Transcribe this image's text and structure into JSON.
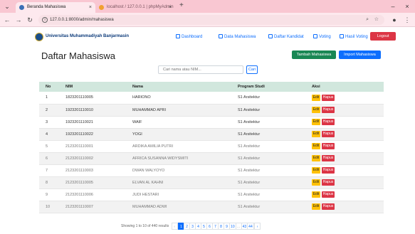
{
  "browser": {
    "tabs": [
      {
        "title": "Beranda Mahasiswa",
        "favicon_color": "#3b6fb6"
      },
      {
        "title": "localhost / 127.0.0.1 | phpMyAdmin",
        "favicon_color": "#f0a030"
      }
    ],
    "url": "127.0.0.1:8000/admin/mahasiswa",
    "new_tab": "+",
    "tab_close": "×",
    "win_controls": {
      "minimize": "–",
      "close": "×",
      "menu": "⌄"
    },
    "nav": {
      "back": "←",
      "forward": "→",
      "reload": "↻"
    },
    "omni_icons": {
      "info": "i",
      "zoom": "⌕",
      "star": "☆",
      "profile": "●",
      "kebab": "⋮"
    }
  },
  "navbar": {
    "brand": "Universitas Muhammadiyah Banjarmasin",
    "links": [
      {
        "label": "Dashboard",
        "icon": "dashboard-icon"
      },
      {
        "label": "Data Mahasiswa",
        "icon": "users-icon"
      },
      {
        "label": "Daftar Kandidat",
        "icon": "list-icon"
      },
      {
        "label": "Voting",
        "icon": "vote-icon"
      },
      {
        "label": "Hasil Voting",
        "icon": "chart-icon"
      }
    ],
    "logout": "Logout"
  },
  "page": {
    "title": "Daftar Mahasiswa",
    "add_button": "Tambah Mahasiswa",
    "import_button": "Import Mahasiswa",
    "search_placeholder": "Cari nama atau NIM...",
    "search_button": "Cari"
  },
  "table": {
    "columns": [
      "No",
      "NIM",
      "Nama",
      "Program Studi",
      "Aksi"
    ],
    "rows": [
      {
        "no": "1",
        "nim": "1823201110005",
        "nama": "HARIONO",
        "prodi": "S1 Arsitektur"
      },
      {
        "no": "2",
        "nim": "1923201110010",
        "nama": "MUHAMMAD APRI",
        "prodi": "S1 Arsitektur"
      },
      {
        "no": "3",
        "nim": "1923201110021",
        "nama": "WAIF",
        "prodi": "S1 Arsitektur"
      },
      {
        "no": "4",
        "nim": "1923201110022",
        "nama": "YOGI",
        "prodi": "S1 Arsitektur"
      },
      {
        "no": "5",
        "nim": "2123201110001",
        "nama": "ARDIKA AMILIA PUTRI",
        "prodi": "S1 Arsitektur"
      },
      {
        "no": "6",
        "nim": "2123201110002",
        "nama": "AFRICA SUSANNA WIDYSMITI",
        "prodi": "S1 Arsitektur"
      },
      {
        "no": "7",
        "nim": "2123201110003",
        "nama": "DWAN WALYOYO",
        "prodi": "S1 Arsitektur"
      },
      {
        "no": "8",
        "nim": "2123201110005",
        "nama": "ELVAN AL KAHNI",
        "prodi": "S1 Arsitektur"
      },
      {
        "no": "9",
        "nim": "2123201110006",
        "nama": "JUDI HESTARI",
        "prodi": "S1 Arsitektur"
      },
      {
        "no": "10",
        "nim": "2123201110007",
        "nama": "MUHAMMAD ADWI",
        "prodi": "S1 Arsitektur"
      }
    ],
    "edit_label": "Edit",
    "delete_label": "Hapus"
  },
  "pagination": {
    "info": "Showing 1 to 10 of 440 results",
    "prev": "‹",
    "pages": [
      "1",
      "2",
      "3",
      "4",
      "5",
      "6",
      "7",
      "8",
      "9",
      "10",
      "...",
      "43",
      "44"
    ],
    "active_page": "1",
    "next": "›"
  },
  "colors": {
    "browser_tabbar": "#f9c7d2",
    "brand_blue": "#0d3b7a",
    "primary": "#0d6efd",
    "success": "#198754",
    "danger": "#dc3545",
    "warning": "#ffc107",
    "table_header": "#d1e7dd"
  }
}
